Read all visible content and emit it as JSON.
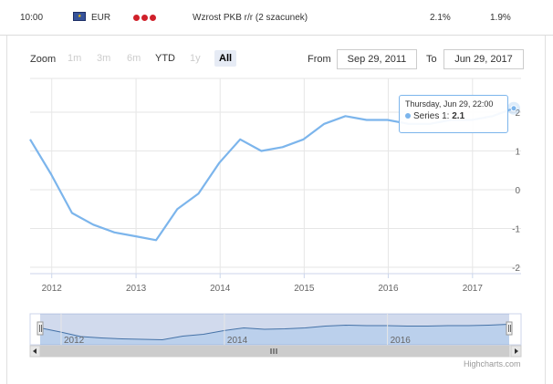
{
  "topbar": {
    "time": "10:00",
    "currency": "EUR",
    "event": "Wzrost PKB r/r (2 szacunek)",
    "actual": "2.1%",
    "forecast": "1.9%"
  },
  "range_selector": {
    "zoom_label": "Zoom",
    "buttons": [
      "1m",
      "3m",
      "6m",
      "YTD",
      "1y",
      "All"
    ],
    "selected": "All",
    "from_label": "From",
    "from_value": "Sep 29, 2011",
    "to_label": "To",
    "to_value": "Jun 29, 2017"
  },
  "tooltip": {
    "date": "Thursday, Jun 29, 22:00",
    "series_label": "Series 1: ",
    "series_value": "2.1"
  },
  "credits": "Highcharts.com",
  "navigator": {
    "labels": [
      "2012",
      "2014",
      "2016"
    ]
  },
  "chart_data": {
    "type": "line",
    "title": "",
    "xlabel": "",
    "ylabel": "",
    "x_tick_labels": [
      "2012",
      "2013",
      "2014",
      "2015",
      "2016",
      "2017"
    ],
    "y_tick_labels": [
      "-2",
      "-1",
      "0",
      "1",
      "2"
    ],
    "ylim": [
      -2,
      2
    ],
    "grid": true,
    "series": [
      {
        "color": "#7cb5ec",
        "points": [
          [
            "2011-09-29",
            1.3
          ],
          [
            "2011-12-29",
            0.4
          ],
          [
            "2012-03-29",
            -0.6
          ],
          [
            "2012-06-29",
            -0.9
          ],
          [
            "2012-09-29",
            -1.1
          ],
          [
            "2012-12-29",
            -1.2
          ],
          [
            "2013-03-29",
            -1.3
          ],
          [
            "2013-06-29",
            -0.5
          ],
          [
            "2013-09-29",
            -0.1
          ],
          [
            "2013-12-29",
            0.7
          ],
          [
            "2014-03-29",
            1.3
          ],
          [
            "2014-06-29",
            1.0
          ],
          [
            "2014-09-29",
            1.1
          ],
          [
            "2014-12-29",
            1.3
          ],
          [
            "2015-03-29",
            1.7
          ],
          [
            "2015-06-29",
            1.9
          ],
          [
            "2015-09-29",
            1.8
          ],
          [
            "2015-12-29",
            1.8
          ],
          [
            "2016-03-29",
            1.7
          ],
          [
            "2016-06-29",
            1.7
          ],
          [
            "2016-09-29",
            1.8
          ],
          [
            "2016-12-29",
            1.8
          ],
          [
            "2017-03-29",
            1.9
          ],
          [
            "2017-06-29",
            2.1
          ]
        ]
      }
    ]
  }
}
